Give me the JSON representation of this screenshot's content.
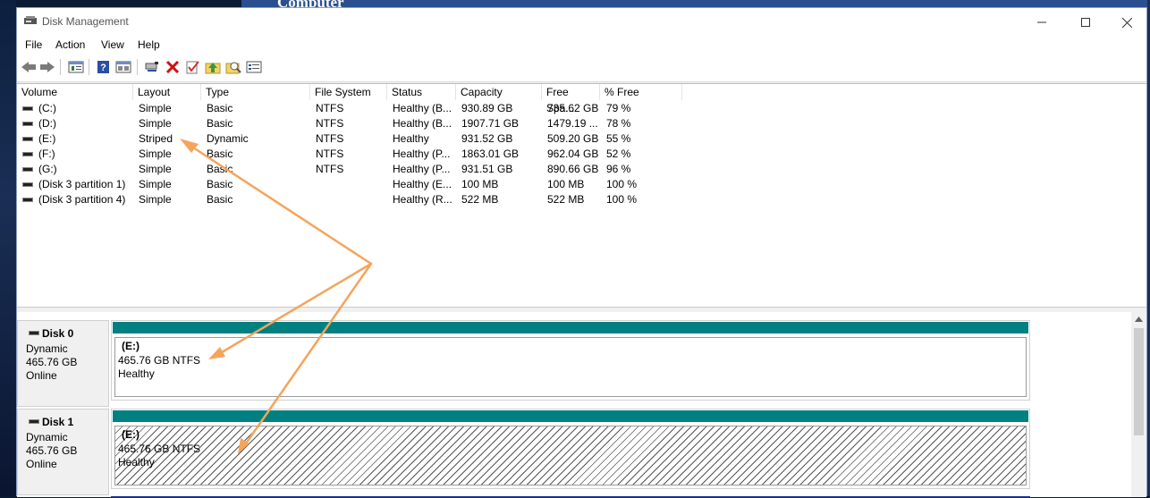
{
  "background": {
    "logo_text": "Computer"
  },
  "window": {
    "title": "Disk Management",
    "controls": [
      "minimize",
      "maximize",
      "close"
    ]
  },
  "menu": [
    "File",
    "Action",
    "View",
    "Help"
  ],
  "toolbar": [
    "back-icon",
    "forward-icon",
    "show-hide-console-tree-icon",
    "help-icon",
    "properties-icon",
    "connect-icon",
    "delete-icon",
    "check-icon",
    "up-folder-icon",
    "search-icon",
    "list-view-icon"
  ],
  "volumes": {
    "headers": [
      "Volume",
      "Layout",
      "Type",
      "File System",
      "Status",
      "Capacity",
      "Free Spa...",
      "% Free"
    ],
    "rows": [
      [
        "(C:)",
        "Simple",
        "Basic",
        "NTFS",
        "Healthy (B...",
        "930.89 GB",
        "735.62 GB",
        "79 %"
      ],
      [
        "(D:)",
        "Simple",
        "Basic",
        "NTFS",
        "Healthy (B...",
        "1907.71 GB",
        "1479.19 ...",
        "78 %"
      ],
      [
        "(E:)",
        "Striped",
        "Dynamic",
        "NTFS",
        "Healthy",
        "931.52 GB",
        "509.20 GB",
        "55 %"
      ],
      [
        "(F:)",
        "Simple",
        "Basic",
        "NTFS",
        "Healthy (P...",
        "1863.01 GB",
        "962.04 GB",
        "52 %"
      ],
      [
        "(G:)",
        "Simple",
        "Basic",
        "NTFS",
        "Healthy (P...",
        "931.51 GB",
        "890.66 GB",
        "96 %"
      ],
      [
        "(Disk 3 partition 1)",
        "Simple",
        "Basic",
        "",
        "Healthy (E...",
        "100 MB",
        "100 MB",
        "100 %"
      ],
      [
        "(Disk 3 partition 4)",
        "Simple",
        "Basic",
        "",
        "Healthy (R...",
        "522 MB",
        "522 MB",
        "100 %"
      ]
    ]
  },
  "disks": [
    {
      "name": "Disk 0",
      "type": "Dynamic",
      "size": "465.76 GB",
      "state": "Online",
      "partition": {
        "label": "(E:)",
        "info": "465.76 GB NTFS",
        "status": "Healthy"
      }
    },
    {
      "name": "Disk 1",
      "type": "Dynamic",
      "size": "465.76 GB",
      "state": "Online",
      "partition": {
        "label": "(E:)",
        "info": "465.76 GB NTFS",
        "status": "Healthy"
      }
    }
  ],
  "colors": {
    "partition_bar": "#008080",
    "annotation_arrow": "#f5a45b"
  }
}
